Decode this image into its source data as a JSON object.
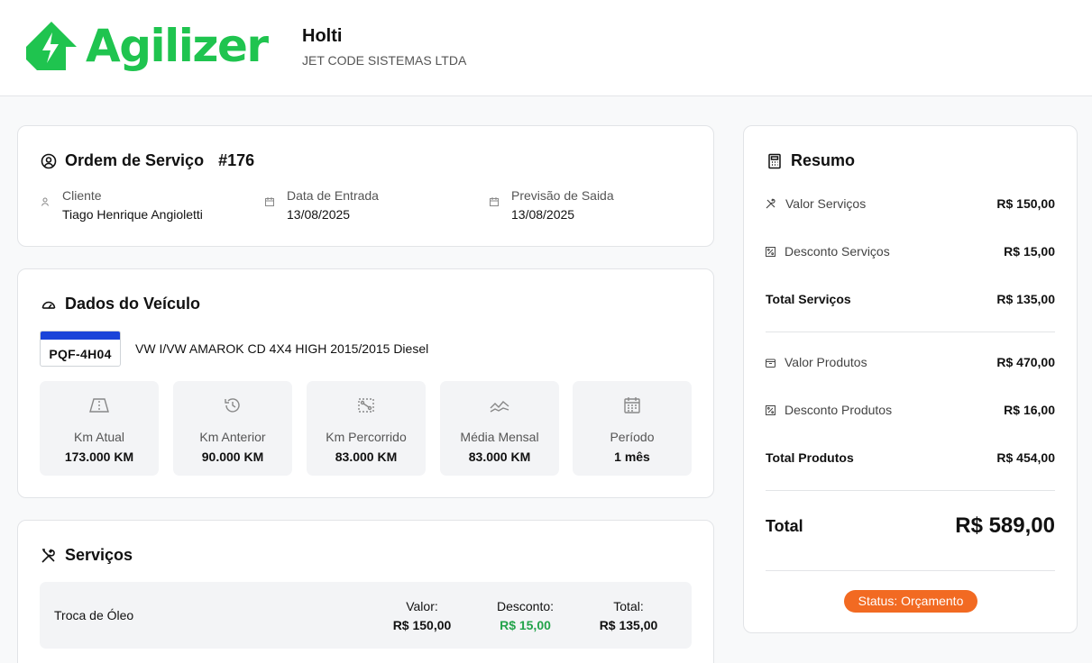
{
  "brand": {
    "name": "Agilizer",
    "color": "#1fc44f"
  },
  "company": {
    "name": "Holti",
    "legal_name": "JET CODE SISTEMAS LTDA"
  },
  "order": {
    "title": "Ordem de Serviço",
    "number": "#176",
    "client_label": "Cliente",
    "client_value": "Tiago Henrique Angioletti",
    "entry_label": "Data de Entrada",
    "entry_value": "13/08/2025",
    "exit_label": "Previsão de Saida",
    "exit_value": "13/08/2025"
  },
  "vehicle": {
    "title": "Dados do Veículo",
    "plate": "PQF-4H04",
    "description": "VW I/VW AMAROK CD 4X4 HIGH 2015/2015 Diesel",
    "stats": [
      {
        "icon": "road-icon",
        "label": "Km Atual",
        "value": "173.000 KM"
      },
      {
        "icon": "history-icon",
        "label": "Km Anterior",
        "value": "90.000 KM"
      },
      {
        "icon": "route-icon",
        "label": "Km Percorrido",
        "value": "83.000 KM"
      },
      {
        "icon": "trend-icon",
        "label": "Média Mensal",
        "value": "83.000 KM"
      },
      {
        "icon": "calendar-icon",
        "label": "Período",
        "value": "1 mês"
      }
    ]
  },
  "services": {
    "title": "Serviços",
    "items": [
      {
        "name": "Troca de Óleo",
        "value_label": "Valor:",
        "value": "R$ 150,00",
        "discount_label": "Desconto:",
        "discount": "R$ 15,00",
        "total_label": "Total:",
        "total": "R$ 135,00"
      }
    ]
  },
  "summary": {
    "title": "Resumo",
    "services_value_label": "Valor Serviços",
    "services_value": "R$ 150,00",
    "services_discount_label": "Desconto Serviços",
    "services_discount": "R$ 15,00",
    "services_total_label": "Total Serviços",
    "services_total": "R$ 135,00",
    "products_value_label": "Valor Produtos",
    "products_value": "R$ 470,00",
    "products_discount_label": "Desconto Produtos",
    "products_discount": "R$ 16,00",
    "products_total_label": "Total Produtos",
    "products_total": "R$ 454,00",
    "total_label": "Total",
    "total_value": "R$ 589,00",
    "status": "Status: Orçamento",
    "status_color": "#f26a22",
    "discount_color": "#22a34a"
  }
}
